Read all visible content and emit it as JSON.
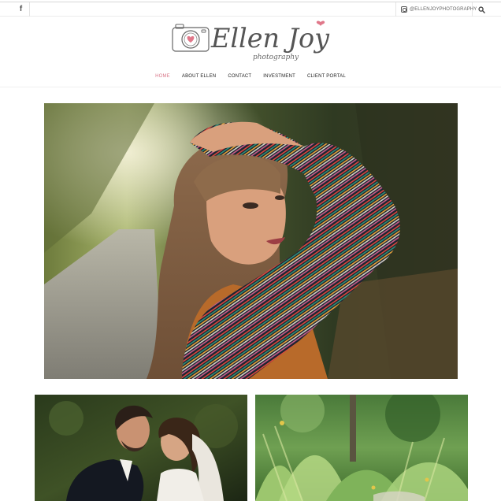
{
  "topbar": {
    "facebook_icon": "facebook-icon",
    "instagram_icon": "instagram-icon",
    "instagram_handle": "@ELLENJOYPHOTOGRAPHY",
    "search_icon": "search-icon"
  },
  "logo": {
    "icon": "camera-heart-icon",
    "name": "Ellen Joy",
    "tagline": "photography",
    "accent_color": "#e0788a"
  },
  "nav": {
    "items": [
      {
        "label": "HOME",
        "active": true
      },
      {
        "label": "ABOUT ELLEN",
        "active": false
      },
      {
        "label": "CONTACT",
        "active": false
      },
      {
        "label": "INVESTMENT",
        "active": false
      },
      {
        "label": "CLIENT PORTAL",
        "active": false
      }
    ],
    "active_color": "#d9788a"
  },
  "gallery": {
    "hero": "portrait of woman with bangs in striped sweater on forest road",
    "tiles": [
      "wedding couple embracing",
      "green garden foliage"
    ]
  }
}
